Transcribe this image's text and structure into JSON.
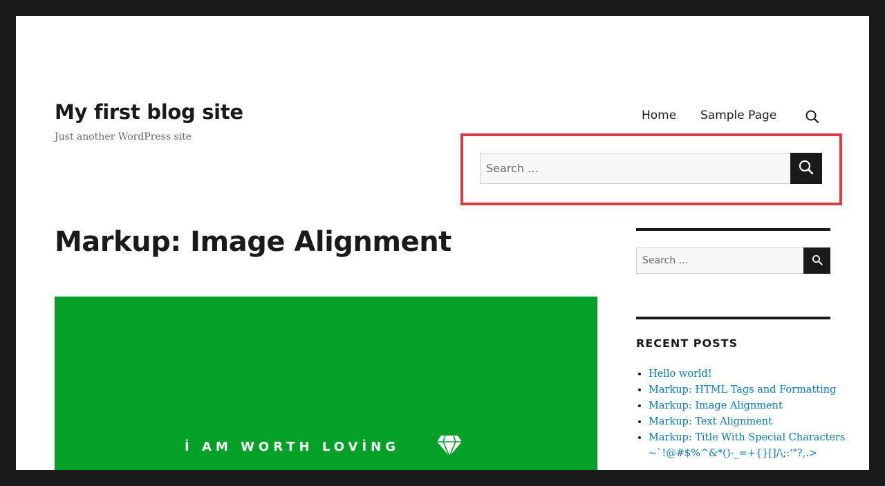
{
  "site": {
    "title": "My first blog site",
    "tagline": "Just another WordPress site"
  },
  "nav": {
    "items": [
      {
        "label": "Home"
      },
      {
        "label": "Sample Page"
      }
    ],
    "search_icon": "search-icon"
  },
  "header_search": {
    "placeholder": "Search …",
    "button_icon": "search-icon",
    "highlight_color": "#dc3a45"
  },
  "main": {
    "entry_title": "Markup: Image Alignment",
    "featured_image": {
      "caption": "İ AM WORTH LOVİNG",
      "icon": "diamond-icon",
      "background": "#03a127"
    }
  },
  "sidebar": {
    "search": {
      "placeholder": "Search …",
      "button_icon": "search-icon"
    },
    "recent_posts": {
      "title": "RECENT POSTS",
      "items": [
        "Hello world!",
        "Markup: HTML Tags and Formatting",
        "Markup: Image Alignment",
        "Markup: Text Alignment",
        "Markup: Title With Special Characters ~`!@#$%^&*()-_=+{}[]/\\;:'\"?,.>"
      ]
    }
  },
  "colors": {
    "link": "#007acc",
    "text": "#1a1a1a",
    "frame": "#1a1a1a"
  }
}
